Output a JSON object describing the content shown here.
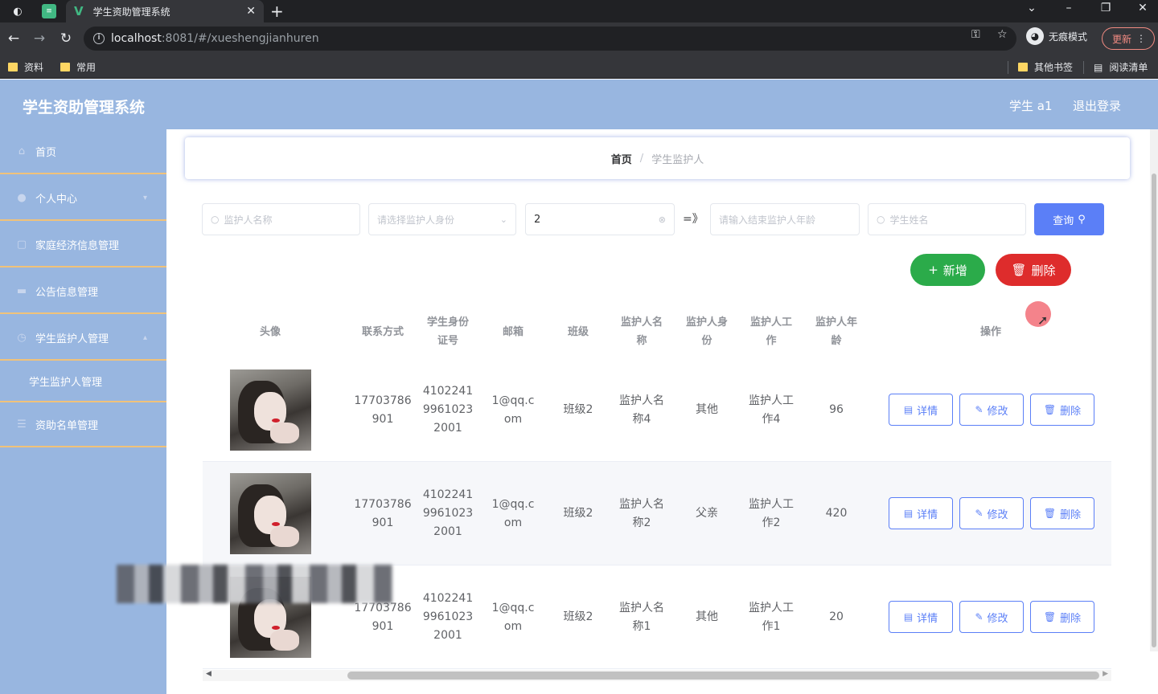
{
  "browser": {
    "tab_title": "学生资助管理系统",
    "url_host": "localhost",
    "url_path": ":8081/#/xueshengjianhuren",
    "incognito_label": "无痕模式",
    "update_label": "更新",
    "bookmarks": [
      "资料",
      "常用"
    ],
    "other_bookmarks": "其他书签",
    "reading_list": "阅读清单"
  },
  "header": {
    "title": "学生资助管理系统",
    "user": "学生 a1",
    "logout": "退出登录"
  },
  "sidebar": {
    "items": [
      {
        "label": "首页",
        "icon": "home-icon"
      },
      {
        "label": "个人中心",
        "icon": "user-icon"
      },
      {
        "label": "家庭经济信息管理",
        "icon": "document-icon"
      },
      {
        "label": "公告信息管理",
        "icon": "briefcase-icon"
      },
      {
        "label": "学生监护人管理",
        "icon": "clock-icon"
      }
    ],
    "subitem": "学生监护人管理",
    "last_item": {
      "label": "资助名单管理",
      "icon": "list-icon"
    }
  },
  "breadcrumb": {
    "home": "首页",
    "separator": "/",
    "current": "学生监护人"
  },
  "search": {
    "guardian_name_placeholder": "监护人名称",
    "identity_placeholder": "请选择监护人身份",
    "age_start_value": "2",
    "arrow": "=》",
    "age_end_placeholder": "请输入结束监护人年龄",
    "student_name_placeholder": "学生姓名",
    "query_label": "查询"
  },
  "actions": {
    "add_label": "新增",
    "delete_label": "删除"
  },
  "table": {
    "headers": [
      "头像",
      "联系方式",
      "学生身份证号",
      "邮箱",
      "班级",
      "监护人名称",
      "监护人身份",
      "监护人工作",
      "监护人年龄",
      "操作"
    ],
    "rows": [
      {
        "phone": "17703786901",
        "id_card": "410224199610232001",
        "email": "1@qq.com",
        "class": "班级2",
        "guardian_name": "监护人名称4",
        "identity": "其他",
        "work": "监护人工作4",
        "age": "96"
      },
      {
        "phone": "17703786901",
        "id_card": "410224199610232001",
        "email": "1@qq.com",
        "class": "班级2",
        "guardian_name": "监护人名称2",
        "identity": "父亲",
        "work": "监护人工作2",
        "age": "420"
      },
      {
        "phone": "17703786901",
        "id_card": "410224199610232001",
        "email": "1@qq.com",
        "class": "班级2",
        "guardian_name": "监护人名称1",
        "identity": "其他",
        "work": "监护人工作1",
        "age": "20"
      }
    ],
    "op_detail": "详情",
    "op_edit": "修改",
    "op_delete": "删除"
  },
  "colors": {
    "header_bg": "#98b6e0",
    "primary": "#5b7ff7",
    "success": "#2bab4a",
    "danger": "#de2c2c",
    "menu_divider": "#f0c27a"
  }
}
